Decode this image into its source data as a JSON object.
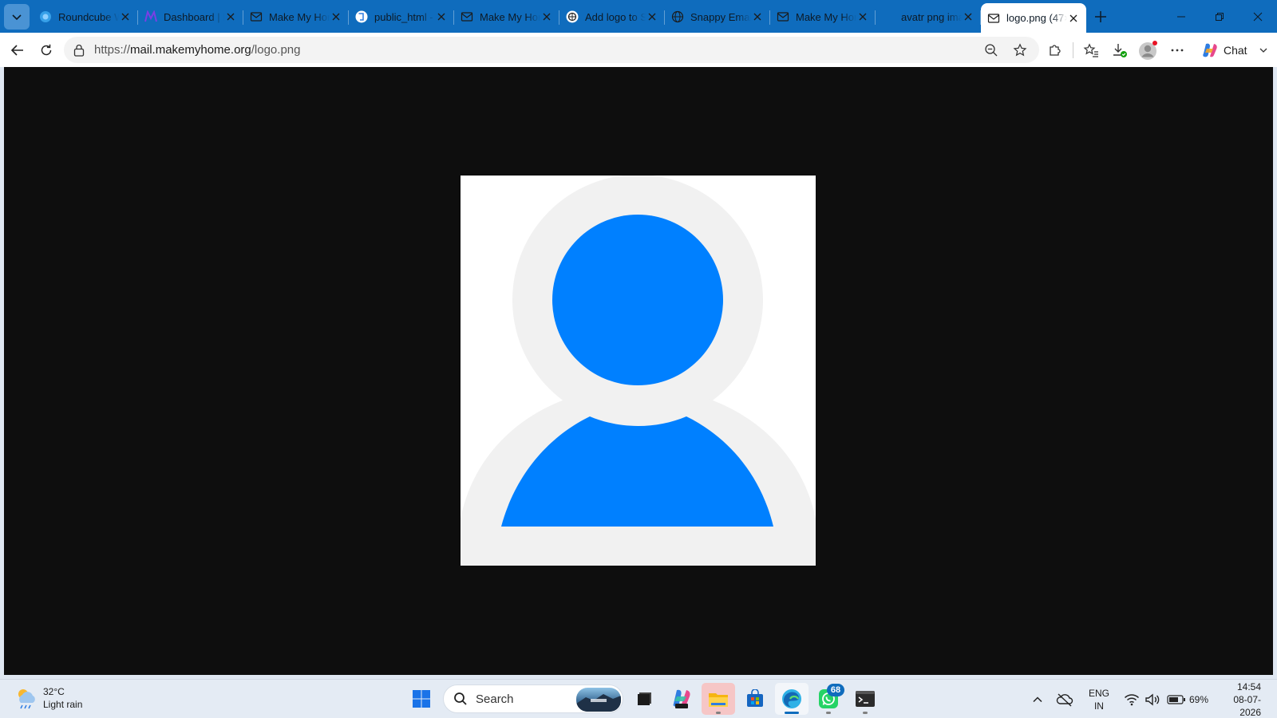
{
  "tabs": [
    {
      "title": "Roundcube W",
      "icon": "roundcube-icon",
      "active": false
    },
    {
      "title": "Dashboard | M",
      "icon": "dashboard-icon",
      "active": false
    },
    {
      "title": "Make My Home",
      "icon": "mail-icon",
      "active": false
    },
    {
      "title": "public_html - Fi",
      "icon": "cpanel-icon",
      "active": false
    },
    {
      "title": "Make My Home",
      "icon": "mail-icon",
      "active": false
    },
    {
      "title": "Add logo to Sn",
      "icon": "chatgpt-icon",
      "active": false
    },
    {
      "title": "Snappy Email",
      "icon": "globe-icon",
      "active": false
    },
    {
      "title": "Make My Home",
      "icon": "mail-icon",
      "active": false
    },
    {
      "title": "avatr png imag",
      "icon": "blank-icon",
      "active": false
    },
    {
      "title": "logo.png (47×",
      "icon": "mail-icon",
      "active": true
    }
  ],
  "address": {
    "url_prefix": "https://",
    "url_host": "mail.makemyhome.org",
    "url_path": "/logo.png"
  },
  "toolbar": {
    "chat_label": "Chat"
  },
  "image": {
    "description_icon": "user-avatar-icon",
    "colors": {
      "figure": "#0080ff",
      "halo": "#f2f2f2",
      "background": "#ffffff"
    }
  },
  "taskbar": {
    "weather_temp": "32°C",
    "weather_cond": "Light rain",
    "search_label": "Search",
    "whatsapp_badge": "68",
    "lang_line1": "ENG",
    "lang_line2": "IN",
    "battery": "69%",
    "time": "14:54",
    "date": "08-07-2026"
  },
  "colors": {
    "accent": "#0f6cbd",
    "viewport_bg": "#0e0e0e"
  }
}
